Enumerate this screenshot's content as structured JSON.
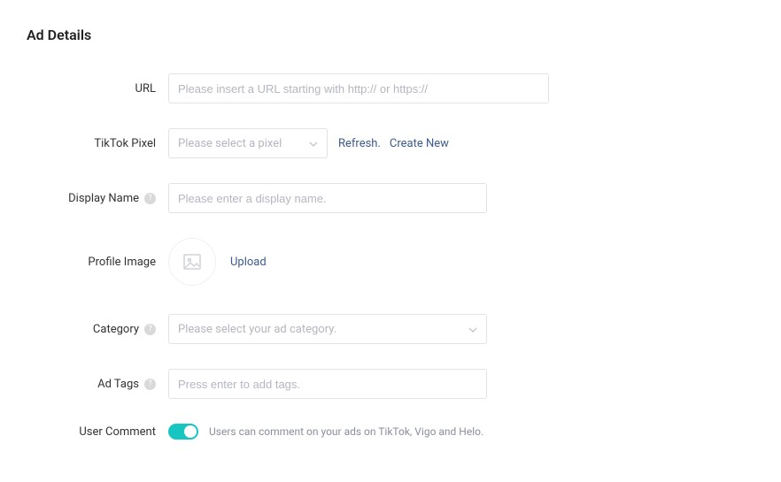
{
  "title": "Ad Details",
  "url": {
    "label": "URL",
    "placeholder": "Please insert a URL starting with http:// or https://"
  },
  "pixel": {
    "label": "TikTok Pixel",
    "placeholder": "Please select a pixel",
    "refresh": "Refresh.",
    "create": "Create New"
  },
  "displayName": {
    "label": "Display Name",
    "placeholder": "Please enter a display name."
  },
  "profileImage": {
    "label": "Profile Image",
    "upload": "Upload"
  },
  "category": {
    "label": "Category",
    "placeholder": "Please select your ad category."
  },
  "adTags": {
    "label": "Ad Tags",
    "placeholder": "Press enter to add tags."
  },
  "userComment": {
    "label": "User Comment",
    "description": "Users can comment on your ads on TikTok, Vigo and Helo.",
    "toggleOn": true
  }
}
